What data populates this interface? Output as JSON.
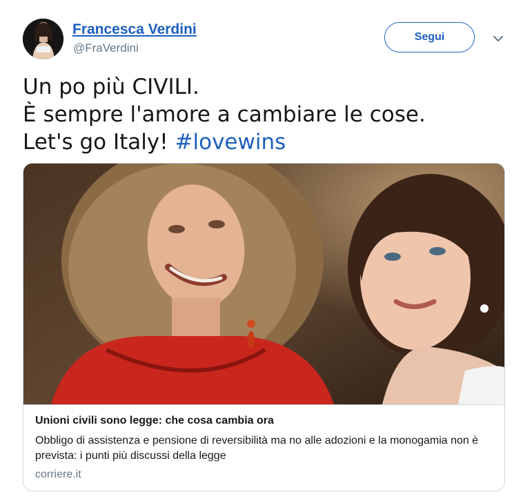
{
  "user": {
    "display_name": "Francesca Verdini",
    "handle": "@FraVerdini"
  },
  "follow_label": "Segui",
  "icons": {
    "menu": "chevron-down-icon"
  },
  "tweet": {
    "line1": "Un po più CIVILI.",
    "line2": "È sempre l'amore a cambiare le cose.",
    "line3_text": "Let's go Italy! ",
    "hashtag": "#lovewins"
  },
  "card": {
    "title": "Unioni civili sono legge: che cosa cambia ora",
    "description": "Obbligo di assistenza e pensione di reversibilità ma no alle adozioni e la monogamia non è prevista: i punti più discussi della legge",
    "domain": "corriere.it"
  },
  "colors": {
    "link_blue": "#1c5fbf",
    "secondary_text": "#657786",
    "border": "#ccd6dd"
  }
}
